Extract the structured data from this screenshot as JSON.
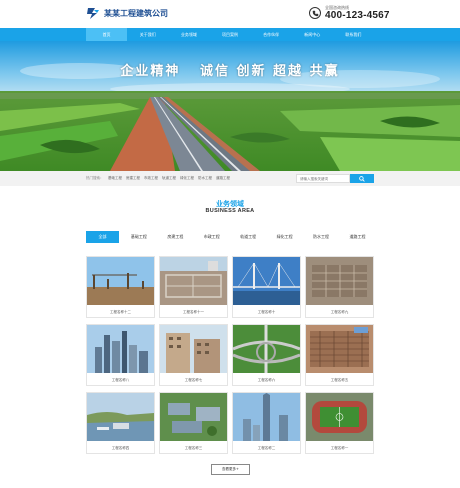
{
  "header": {
    "company_name": "某某工程建筑公司",
    "hotline_label": "全国咨询热线",
    "hotline_number": "400-123-4567"
  },
  "nav": {
    "items": [
      {
        "label": "首页",
        "active": true
      },
      {
        "label": "关于我们",
        "active": false
      },
      {
        "label": "业务领域",
        "active": false
      },
      {
        "label": "项目案例",
        "active": false
      },
      {
        "label": "合作伙伴",
        "active": false
      },
      {
        "label": "新闻中心",
        "active": false
      },
      {
        "label": "联系我们",
        "active": false
      }
    ]
  },
  "banner": {
    "slogan": "企业精神   诚信 创新 超越 共赢"
  },
  "search": {
    "hot_label": "热门搜索：",
    "hot_items": [
      "基础工程",
      "房建工程",
      "市政工程",
      "轨道工程",
      "绿化工程",
      "防水工程",
      "道路工程"
    ],
    "placeholder": "请输入搜索关键词"
  },
  "section": {
    "title": "业务领域",
    "subtitle": "BUSINESS AREA",
    "tabs": [
      {
        "label": "全部",
        "active": true
      },
      {
        "label": "基础工程",
        "active": false
      },
      {
        "label": "房建工程",
        "active": false
      },
      {
        "label": "市政工程",
        "active": false
      },
      {
        "label": "轨道工程",
        "active": false
      },
      {
        "label": "绿化工程",
        "active": false
      },
      {
        "label": "防水工程",
        "active": false
      },
      {
        "label": "道路工程",
        "active": false
      }
    ],
    "cards": [
      {
        "caption": "工程名称十二",
        "scene": "site"
      },
      {
        "caption": "工程名称十一",
        "scene": "foundation"
      },
      {
        "caption": "工程名称十",
        "scene": "bridge"
      },
      {
        "caption": "工程名称九",
        "scene": "pit"
      },
      {
        "caption": "工程名称八",
        "scene": "skyline"
      },
      {
        "caption": "工程名称七",
        "scene": "building"
      },
      {
        "caption": "工程名称六",
        "scene": "interchange"
      },
      {
        "caption": "工程名称五",
        "scene": "rebar"
      },
      {
        "caption": "工程名称四",
        "scene": "port"
      },
      {
        "caption": "工程名称三",
        "scene": "campus"
      },
      {
        "caption": "工程名称二",
        "scene": "tower"
      },
      {
        "caption": "工程名称一",
        "scene": "stadium"
      }
    ],
    "more_label": "查看更多+"
  },
  "colors": {
    "accent": "#1aa3e8",
    "nav_active": "#4cc0f5",
    "logo_blue": "#1e4f93"
  },
  "icons": {
    "logo": "company-logo-icon",
    "phone": "phone-icon",
    "search": "search-icon"
  }
}
